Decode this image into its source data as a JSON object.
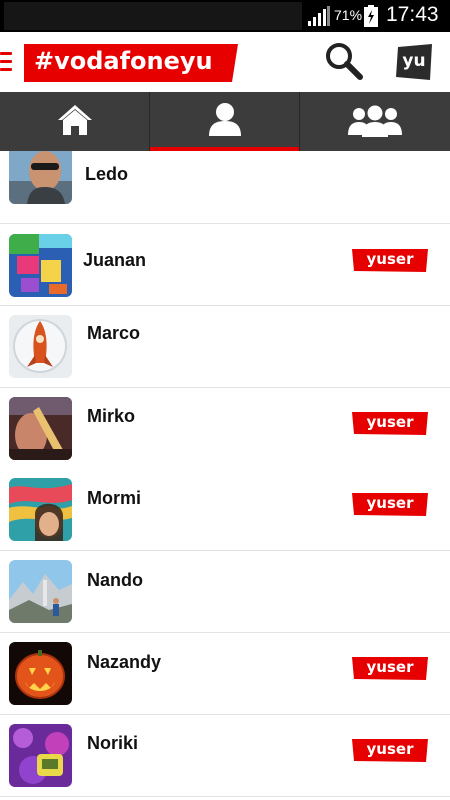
{
  "status_bar": {
    "battery_percent": "71%",
    "time": "17:43",
    "icons": [
      "signal-icon",
      "battery-charging-icon"
    ]
  },
  "app_bar": {
    "logo_text": "#vodafoneyu",
    "yu_button_label": "yu",
    "icons": [
      "menu-icon",
      "search-icon"
    ]
  },
  "tabs": [
    {
      "name": "home",
      "icon": "home-icon",
      "selected": false
    },
    {
      "name": "profile",
      "icon": "user-icon",
      "selected": true
    },
    {
      "name": "groups",
      "icon": "group-icon",
      "selected": false
    }
  ],
  "badge_label": "yuser",
  "colors": {
    "brand_red": "#e60000",
    "tab_bar": "#3c3c3c",
    "status_bar": "#000000"
  },
  "contacts": [
    {
      "name": "Ledo",
      "yuser": false
    },
    {
      "name": "Juanan",
      "yuser": true
    },
    {
      "name": "Marco",
      "yuser": false
    },
    {
      "name": "Mirko",
      "yuser": true
    },
    {
      "name": "Mormi",
      "yuser": true
    },
    {
      "name": "Nando",
      "yuser": false
    },
    {
      "name": "Nazandy",
      "yuser": true
    },
    {
      "name": "Noriki",
      "yuser": true
    }
  ]
}
